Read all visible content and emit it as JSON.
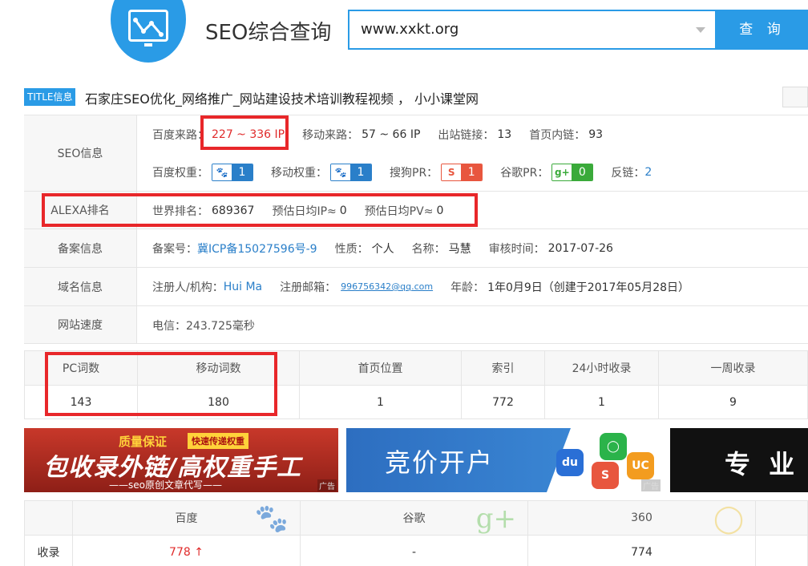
{
  "header": {
    "site_title": "SEO综合查询",
    "search_value": "www.xxkt.org",
    "search_button": "查 询"
  },
  "title_info": {
    "badge": "TITLE信息",
    "text": "石家庄SEO优化_网络推广_网站建设技术培训教程视频 ， 小小课堂网"
  },
  "seo": {
    "label": "SEO信息",
    "baidu_source_label": "百度来路：",
    "baidu_source_value": "227 ~ 336 IP",
    "mobile_source_label": "移动来路：",
    "mobile_source_value": "57 ~ 66 IP",
    "outbound_label": "出站链接：",
    "outbound_value": "13",
    "home_links_label": "首页内链：",
    "home_links_value": "93",
    "baidu_weight_label": "百度权重：",
    "baidu_weight_value": "1",
    "mobile_weight_label": "移动权重：",
    "mobile_weight_value": "1",
    "sogou_pr_label": "搜狗PR：",
    "sogou_pr_value": "1",
    "google_pr_label": "谷歌PR：",
    "google_pr_value": "0",
    "backlinks_label": "反链：",
    "backlinks_value": "2"
  },
  "alexa": {
    "label": "ALEXA排名",
    "world_rank_label": "世界排名：",
    "world_rank_value": "689367",
    "daily_ip_label": "预估日均IP≈",
    "daily_ip_value": "0",
    "daily_pv_label": "预估日均PV≈",
    "daily_pv_value": "0"
  },
  "icp": {
    "label": "备案信息",
    "number_label": "备案号：",
    "number_value": "冀ICP备15027596号-9",
    "nature_label": "性质：",
    "nature_value": "个人",
    "name_label": "名称：",
    "name_value": "马慧",
    "review_label": "审核时间：",
    "review_value": "2017-07-26"
  },
  "domain": {
    "label": "域名信息",
    "registrant_label": "注册人/机构：",
    "registrant_value": "Hui Ma",
    "email_label": "注册邮箱：",
    "email_value": "996756342@qq.com",
    "age_label": "年龄：",
    "age_value": "1年0月9日（创建于2017年05月28日）"
  },
  "speed": {
    "label": "网站速度",
    "value": "电信：243.725毫秒"
  },
  "words": {
    "headers": [
      "PC词数",
      "移动词数",
      "首页位置",
      "索引",
      "24小时收录",
      "一周收录"
    ],
    "values": [
      "143",
      "180",
      "1",
      "772",
      "1",
      "9"
    ]
  },
  "ads": {
    "ad1_top": "质量保证",
    "ad1_tag": "快速传递权重",
    "ad1_big": "包收录外链/高权重手工",
    "ad1_sub": "——seo原创文章代写——",
    "ad2_big": "竞价开户",
    "ad3_big": "专 业",
    "ad_label": "广告"
  },
  "records": {
    "engines": [
      "百度",
      "谷歌",
      "360"
    ],
    "row_label": "收录",
    "baidu_value": "778",
    "baidu_arrow": "↑",
    "google_value": "-",
    "so360_value": "774"
  },
  "colors": {
    "accent": "#2a9be6",
    "highlight_box": "#e8272a",
    "link": "#2a7fc9"
  }
}
